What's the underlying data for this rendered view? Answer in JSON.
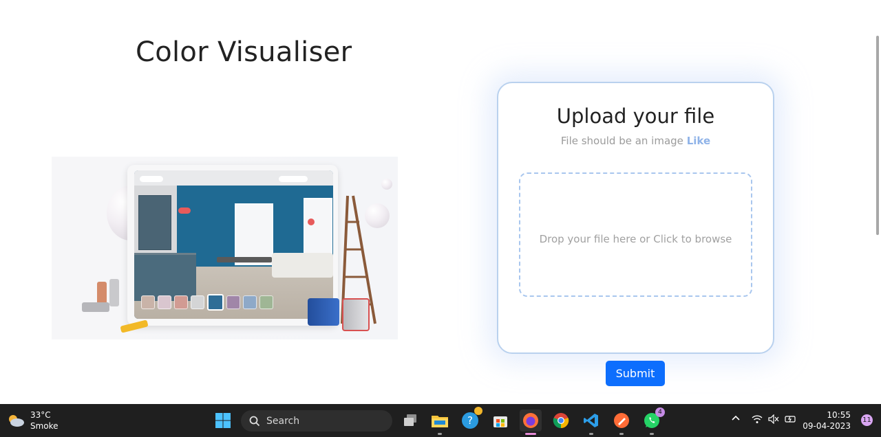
{
  "page": {
    "title": "Color Visualiser",
    "upload": {
      "heading": "Upload your file",
      "hint_prefix": "File should be an image",
      "hint_suffix": "Like",
      "dropzone_text": "Drop your file here or Click to browse",
      "submit_label": "Submit"
    },
    "illustration": {
      "swatch_colors": [
        "#c9b3a8",
        "#d9c6cf",
        "#d19b93",
        "#d4d5d6",
        "#2e6d96",
        "#a086a8",
        "#8ea9c8",
        "#9fb695"
      ],
      "selected_swatch_index": 4
    }
  },
  "taskbar": {
    "weather": {
      "temp": "33°C",
      "condition": "Smoke"
    },
    "search_label": "Search",
    "apps": [
      "task-view",
      "file-explorer",
      "help",
      "microsoft-store",
      "firefox",
      "chrome",
      "vscode",
      "postman",
      "whatsapp"
    ],
    "whatsapp_badge": "4",
    "clock": {
      "time": "10:55",
      "date": "09-04-2023"
    },
    "notification_count": "11"
  }
}
